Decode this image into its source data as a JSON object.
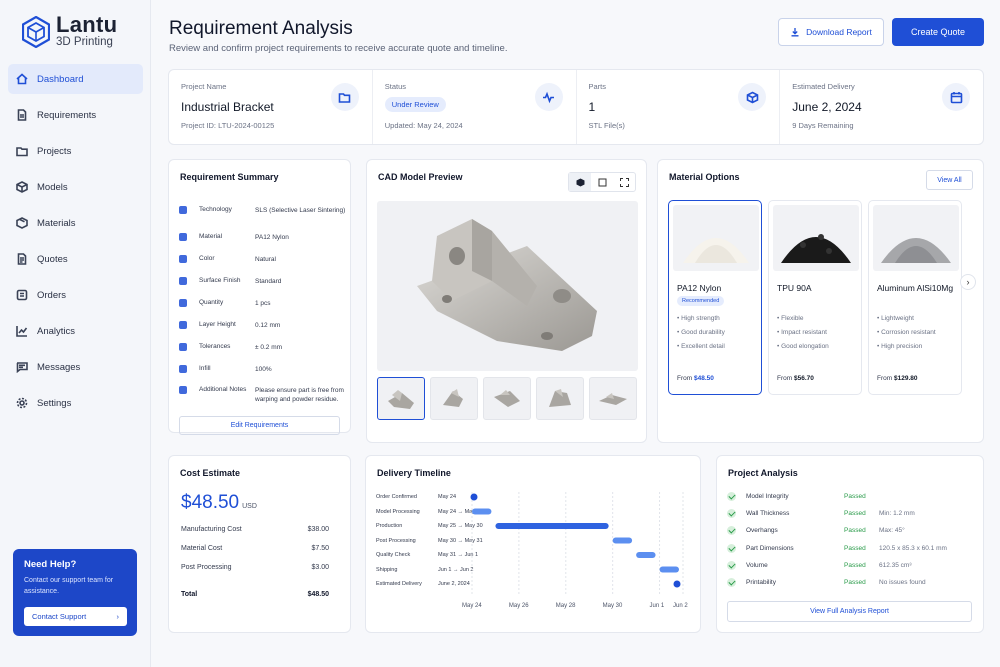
{
  "brand": {
    "name": "Lantu",
    "sub": "3D Printing",
    "accent": "#1f4fd6"
  },
  "sidebar": {
    "items": [
      {
        "label": "Dashboard",
        "icon": "home-icon"
      },
      {
        "label": "Requirements",
        "icon": "document-icon"
      },
      {
        "label": "Projects",
        "icon": "folder-icon"
      },
      {
        "label": "Models",
        "icon": "cube-icon"
      },
      {
        "label": "Materials",
        "icon": "box-icon"
      },
      {
        "label": "Quotes",
        "icon": "file-icon"
      },
      {
        "label": "Orders",
        "icon": "orders-icon"
      },
      {
        "label": "Analytics",
        "icon": "chart-icon"
      },
      {
        "label": "Messages",
        "icon": "message-icon"
      },
      {
        "label": "Settings",
        "icon": "gear-icon"
      }
    ],
    "help": {
      "title": "Need Help?",
      "text": "Contact our support team for assistance.",
      "button": "Contact Support"
    }
  },
  "header": {
    "title": "Requirement Analysis",
    "subtitle": "Review and confirm project requirements to receive accurate quote and timeline.",
    "download_label": "Download Report",
    "create_label": "Create Quote"
  },
  "stats": {
    "project": {
      "label": "Project Name",
      "value": "Industrial Bracket",
      "sub": "Project ID: LTU-2024-00125"
    },
    "status": {
      "label": "Status",
      "value": "Under Review",
      "sub": "Updated: May 24, 2024"
    },
    "parts": {
      "label": "Parts",
      "value": "1",
      "sub": "STL File(s)"
    },
    "delivery": {
      "label": "Estimated Delivery",
      "value": "June 2, 2024",
      "sub": "9 Days Remaining"
    }
  },
  "summary": {
    "title": "Requirement Summary",
    "rows": [
      {
        "label": "Technology",
        "value": "SLS (Selective Laser Sintering)"
      },
      {
        "label": "Material",
        "value": "PA12 Nylon"
      },
      {
        "label": "Color",
        "value": "Natural"
      },
      {
        "label": "Surface Finish",
        "value": "Standard"
      },
      {
        "label": "Quantity",
        "value": "1 pcs"
      },
      {
        "label": "Layer Height",
        "value": "0.12 mm"
      },
      {
        "label": "Tolerances",
        "value": "± 0.2 mm"
      },
      {
        "label": "Infill",
        "value": "100%"
      },
      {
        "label": "Additional Notes",
        "value": "Please ensure part is free from warping and powder residue."
      }
    ],
    "edit_label": "Edit Requirements"
  },
  "cad": {
    "title": "CAD Model Preview"
  },
  "materials": {
    "title": "Material Options",
    "view_all": "View All",
    "options": [
      {
        "name": "PA12 Nylon",
        "badge": "Recommended",
        "features": [
          "High strength",
          "Good durability",
          "Excellent detail"
        ],
        "price_prefix": "From",
        "price": "$48.50"
      },
      {
        "name": "TPU 90A",
        "features": [
          "Flexible",
          "Impact resistant",
          "Good elongation"
        ],
        "price_prefix": "From",
        "price": "$56.70"
      },
      {
        "name": "Aluminum AlSi10Mg",
        "features": [
          "Lightweight",
          "Corrosion resistant",
          "High precision"
        ],
        "price_prefix": "From",
        "price": "$129.80"
      }
    ]
  },
  "cost": {
    "title": "Cost Estimate",
    "amount": "$48.50",
    "currency": "USD",
    "rows": [
      {
        "label": "Manufacturing Cost",
        "value": "$38.00"
      },
      {
        "label": "Material Cost",
        "value": "$7.50"
      },
      {
        "label": "Post Processing",
        "value": "$3.00"
      }
    ],
    "total_label": "Total",
    "total_value": "$48.50"
  },
  "timeline": {
    "title": "Delivery Timeline",
    "axis": [
      "May 24",
      "May 26",
      "May 28",
      "May 30",
      "Jun 1",
      "Jun 2"
    ],
    "rows": [
      {
        "label": "Order Confirmed",
        "dates": "May 24",
        "start": "May 24",
        "end": "May 24",
        "kind": "milestone"
      },
      {
        "label": "Model Processing",
        "dates": "May 24 → May 25",
        "start": "May 24",
        "end": "May 25",
        "kind": "bar"
      },
      {
        "label": "Production",
        "dates": "May 25 → May 30",
        "start": "May 25",
        "end": "May 30",
        "kind": "bar"
      },
      {
        "label": "Post Processing",
        "dates": "May 30 → May 31",
        "start": "May 30",
        "end": "May 31",
        "kind": "bar"
      },
      {
        "label": "Quality Check",
        "dates": "May 31 → Jun 1",
        "start": "May 31",
        "end": "Jun 1",
        "kind": "bar"
      },
      {
        "label": "Shipping",
        "dates": "Jun 1 → Jun 2",
        "start": "Jun 1",
        "end": "Jun 2",
        "kind": "bar"
      },
      {
        "label": "Estimated Delivery",
        "dates": "June 2, 2024",
        "start": "Jun 2",
        "end": "Jun 2",
        "kind": "milestone"
      }
    ]
  },
  "analysis": {
    "title": "Project Analysis",
    "rows": [
      {
        "name": "Model Integrity",
        "status": "Passed",
        "detail": ""
      },
      {
        "name": "Wall Thickness",
        "status": "Passed",
        "detail": "Min: 1.2 mm"
      },
      {
        "name": "Overhangs",
        "status": "Passed",
        "detail": "Max: 45°"
      },
      {
        "name": "Part Dimensions",
        "status": "Passed",
        "detail": "120.5 x 85.3 x 60.1 mm"
      },
      {
        "name": "Volume",
        "status": "Passed",
        "detail": "612.35 cm³"
      },
      {
        "name": "Printability",
        "status": "Passed",
        "detail": "No issues found"
      }
    ],
    "button": "View Full Analysis Report"
  }
}
